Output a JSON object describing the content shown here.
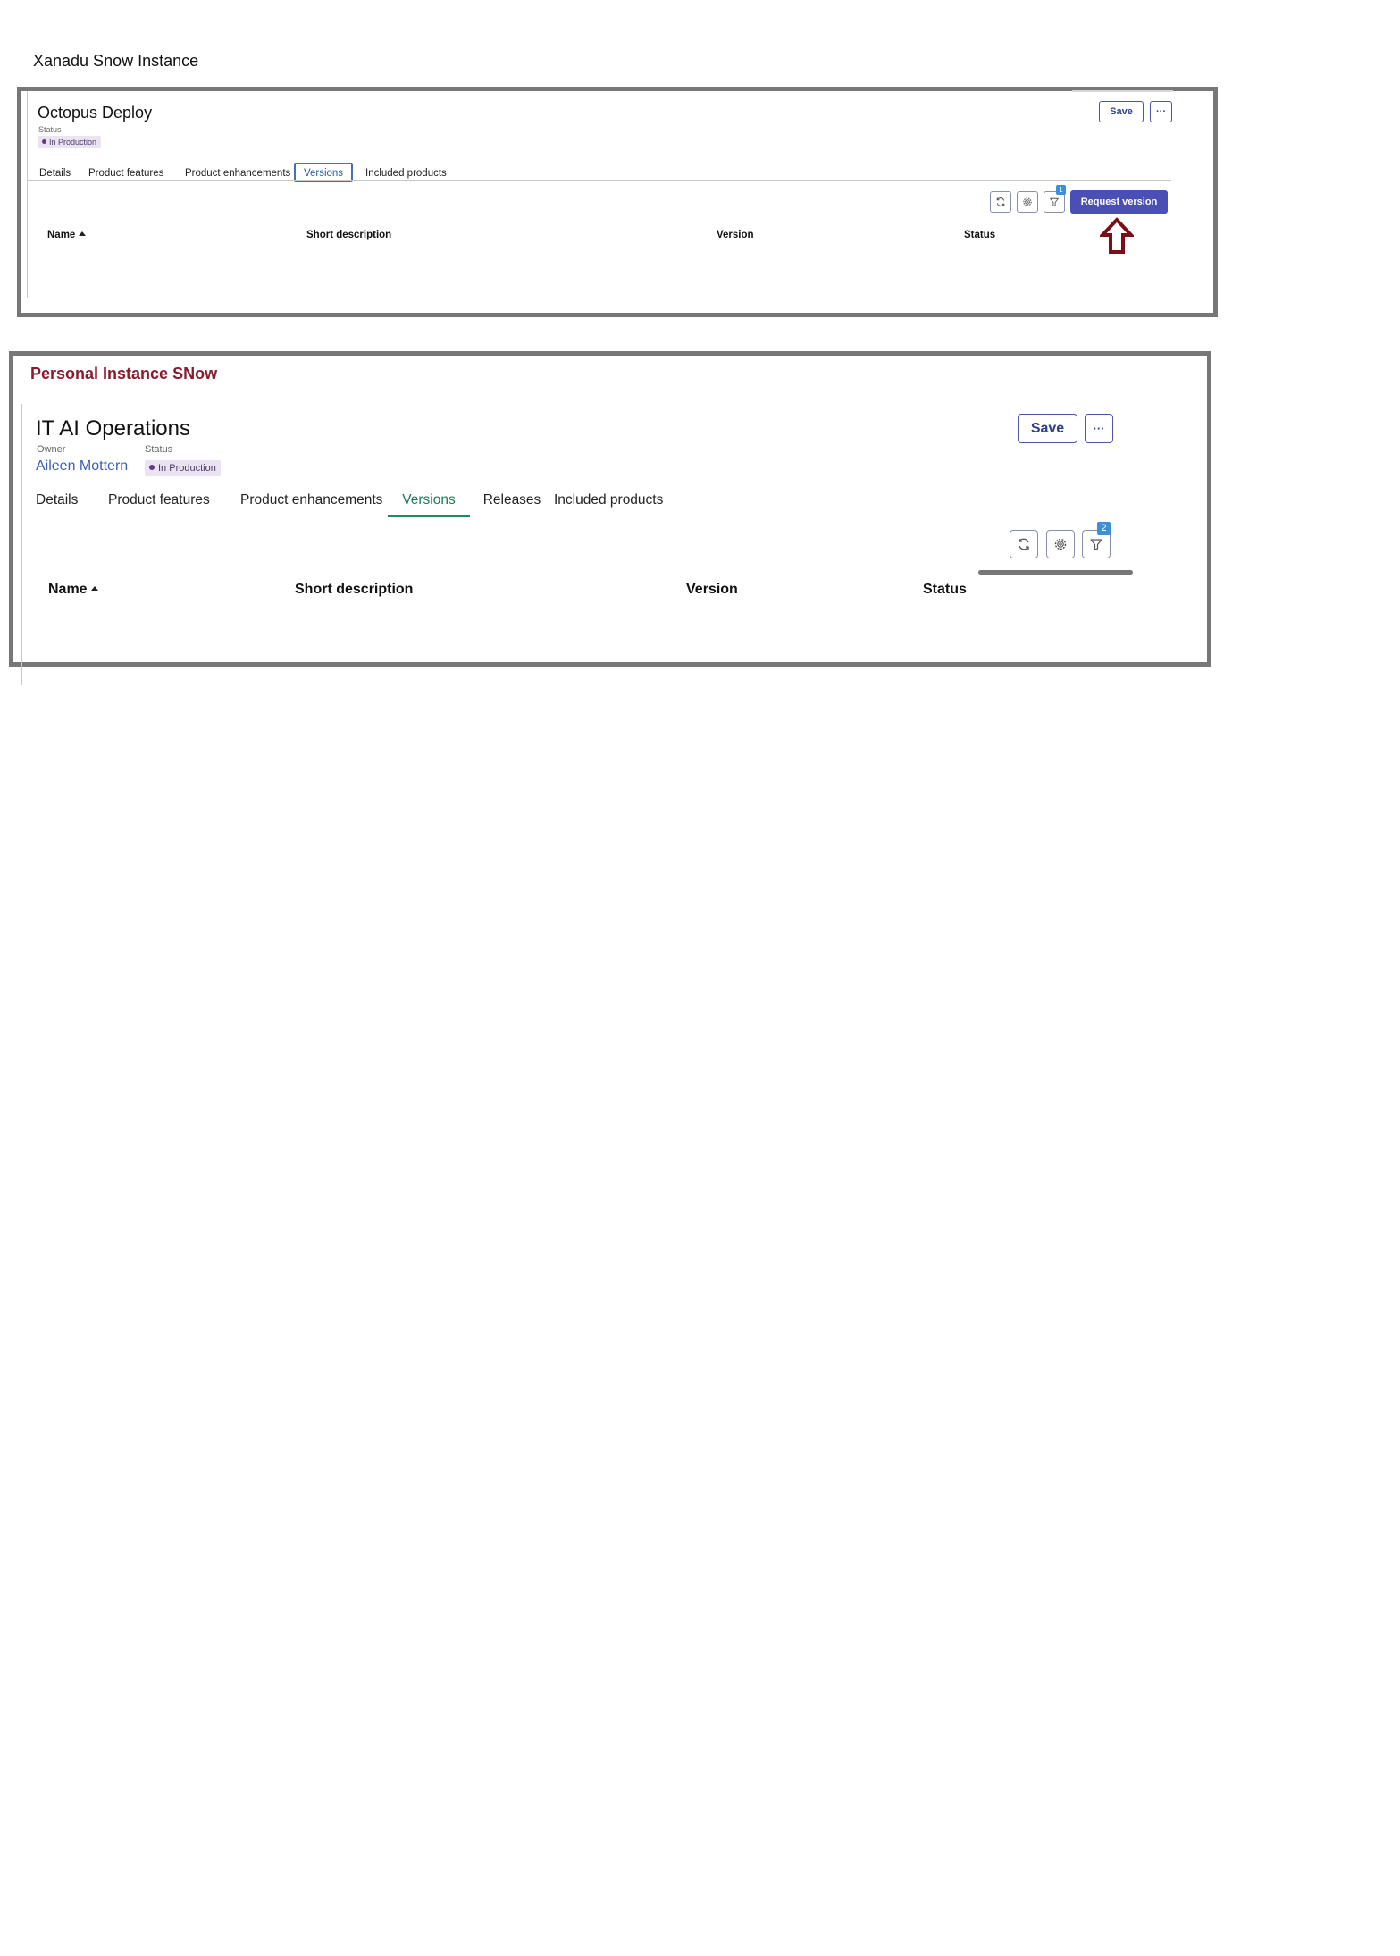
{
  "xanadu": {
    "heading": "Xanadu Snow Instance",
    "record": {
      "title": "Octopus Deploy",
      "status_label": "Status",
      "status_value": "In Production"
    },
    "actions": {
      "save_label": "Save",
      "more_label": "···"
    },
    "tabs": [
      {
        "label": "Details"
      },
      {
        "label": "Product features"
      },
      {
        "label": "Product enhancements"
      },
      {
        "label": "Versions",
        "active": true
      },
      {
        "label": "Included products"
      }
    ],
    "toolbar": {
      "icons": [
        "refresh-icon",
        "gear-icon",
        "filter-icon"
      ],
      "filter_count": "1",
      "request_label": "Request version"
    },
    "annotation": {
      "icon": "arrow-up-icon",
      "color": "#7a0f18"
    },
    "table": {
      "columns": [
        "Name",
        "Short description",
        "Version",
        "Status"
      ],
      "sort_column": "Name",
      "sort_direction": "ascending"
    }
  },
  "personal": {
    "heading": "Personal Instance SNow",
    "heading_color": "#8a1c2e",
    "record": {
      "title": "IT AI Operations",
      "owner_label": "Owner",
      "owner_value": "Aileen Mottern",
      "status_label": "Status",
      "status_value": "In Production"
    },
    "actions": {
      "save_label": "Save",
      "more_label": "···"
    },
    "tabs": [
      {
        "label": "Details"
      },
      {
        "label": "Product features"
      },
      {
        "label": "Product enhancements"
      },
      {
        "label": "Versions",
        "active": true
      },
      {
        "label": "Releases"
      },
      {
        "label": "Included products"
      }
    ],
    "toolbar": {
      "icons": [
        "refresh-icon",
        "gear-icon",
        "filter-icon"
      ],
      "filter_count": "2"
    },
    "table": {
      "columns": [
        "Name",
        "Short description",
        "Version",
        "Status"
      ],
      "sort_column": "Name",
      "sort_direction": "ascending"
    }
  },
  "colors": {
    "primary_button": "#4a4fb3",
    "badge_bg": "#ece3f2",
    "active_tab_green": "#1f7a52",
    "filter_badge": "#3d90d6"
  }
}
